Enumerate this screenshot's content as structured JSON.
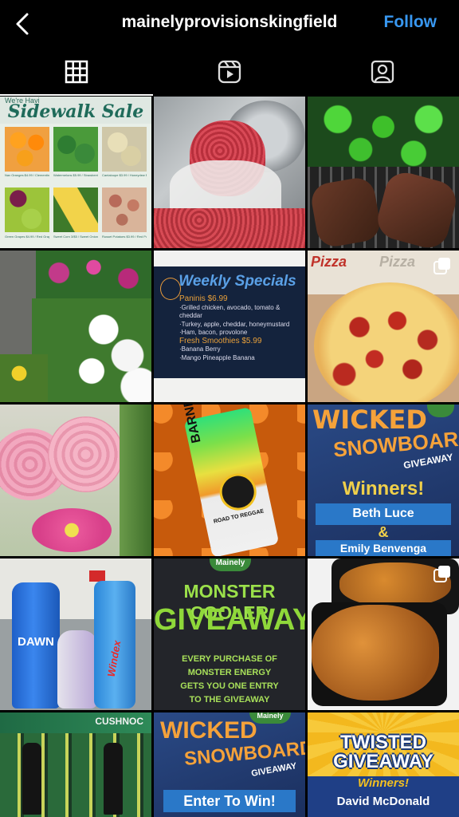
{
  "header": {
    "username": "mainelyprovisionskingfield",
    "follow_label": "Follow"
  },
  "tabs": [
    {
      "name": "grid-tab",
      "active": true
    },
    {
      "name": "reels-tab",
      "active": false
    },
    {
      "name": "tagged-tab",
      "active": false
    }
  ],
  "posts": {
    "p1": {
      "kicker": "We're Havi",
      "title": "Sidewalk Sale",
      "items": [
        "Nav Oranges $4.99 / Clementines $3.99",
        "Watermelons $5.99 / Strawberries $3.99",
        "Cantaloupe $3.99 / Honeydew $4.99",
        "Green Grapes $4.99 / Red Grapes $4.99",
        "Sweet Corn 3/$5 / Sweet Onions $3.99",
        "Russet Potatoes $3.99 / Red Potatoes $3.99"
      ]
    },
    "p5": {
      "title": "Weekly Specials",
      "lines": [
        "Paninis $6.99",
        "·Grilled chicken, avocado, tomato & cheddar",
        "·Turkey, apple, cheddar, honeymustard",
        "·Ham, bacon, provolone",
        "Fresh Smoothies $5.99",
        "·Banana Berry",
        "·Mango Pineapple Banana"
      ]
    },
    "p6": {
      "box_text": "Pizza"
    },
    "p8": {
      "can_brand": "BARNEY",
      "can_name": "ROAD TO REGGAE"
    },
    "p9": {
      "title1": "WICKED",
      "title2": "SNOWBOARD",
      "subtitle": "GIVEAWAY",
      "winners": "Winners!",
      "name1": "Beth Luce",
      "amp": "&",
      "name2": "Emily Benvenga"
    },
    "p10": {
      "brand1": "DAWN",
      "brand2": "Windex"
    },
    "p11": {
      "brand": "Mainely",
      "title1": "MONSTER COOLER",
      "title2": "GIVEAWAY",
      "body": [
        "EVERY PURCHASE OF",
        "MONSTER ENERGY",
        "GETS YOU ONE ENTRY",
        "TO THE GIVEAWAY"
      ]
    },
    "p13": {
      "sign": "CUSHNOC"
    },
    "p14": {
      "brand": "Mainely",
      "title1": "WICKED",
      "title2": "SNOWBOARD",
      "subtitle": "GIVEAWAY",
      "cta": "Enter To Win!"
    },
    "p15": {
      "title1": "TWISTED",
      "title2": "GIVEAWAY",
      "winners": "Winners!",
      "name": "David McDonald"
    }
  },
  "colors": {
    "follow": "#3897f0",
    "background": "#000000"
  }
}
